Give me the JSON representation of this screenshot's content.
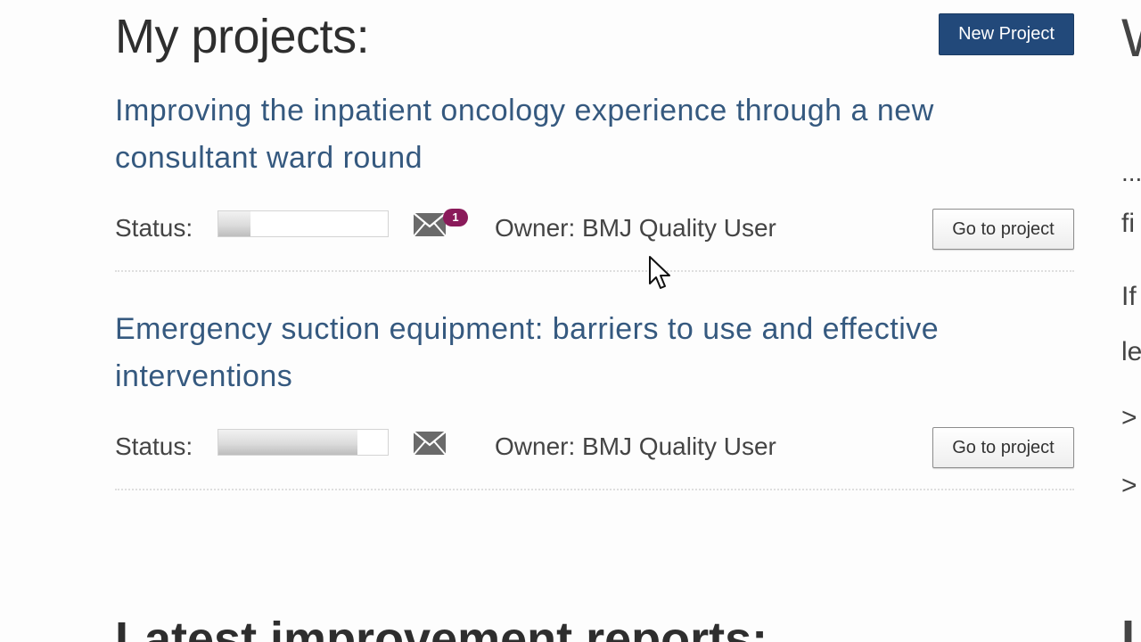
{
  "header": {
    "title": "My projects:",
    "new_project_label": "New Project"
  },
  "projects": [
    {
      "title": "Improving the inpatient oncology experience through a new consultant ward round",
      "status_label": "Status:",
      "progress": 0.19,
      "messages_badge": "1",
      "owner": "Owner: BMJ Quality User",
      "goto_label": "Go to project"
    },
    {
      "title": "Emergency suction equipment: barriers to use and effective interventions",
      "status_label": "Status:",
      "progress": 0.82,
      "messages_badge": "",
      "owner": "Owner: BMJ Quality User",
      "goto_label": "Go to project"
    }
  ],
  "latest": {
    "title": "Latest improvement reports:"
  },
  "right_column": {
    "heading_fragment": "W",
    "line1": "...",
    "line2": "fi",
    "line3": "If",
    "line4": "le",
    "arrow1": ">",
    "arrow2": ">",
    "bottom_fragment": "L"
  },
  "colors": {
    "title_link": "#35597f",
    "primary_button": "#22497a",
    "badge": "#8a1a5a"
  },
  "icons": {
    "mail": "envelope-icon",
    "cursor": "mouse-pointer-icon"
  }
}
